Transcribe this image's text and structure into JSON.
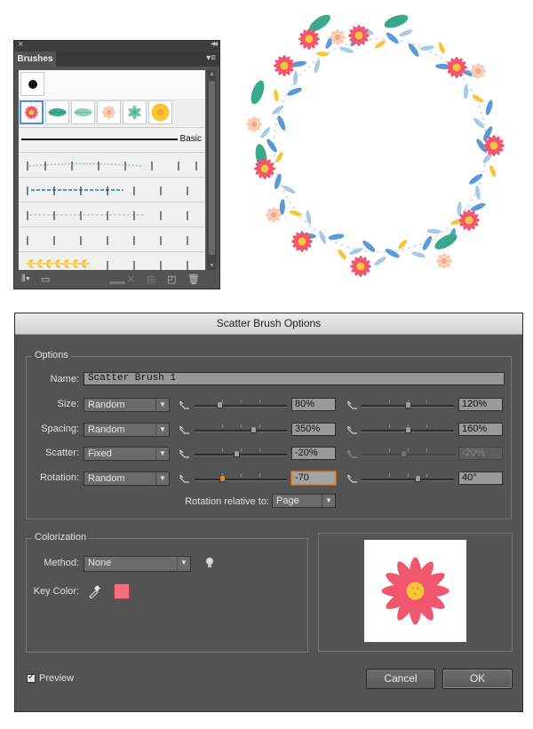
{
  "brushes_panel": {
    "tab_label": "Brushes",
    "close_glyph": "×",
    "collapse_glyph": "◂◂",
    "menu_glyph": "▾≡",
    "basic_label": "Basic",
    "footer_icons": [
      "brush-libraries-icon",
      "libraries-panel-icon",
      "remove-stroke-icon",
      "options-icon",
      "new-brush-icon",
      "delete-brush-icon"
    ],
    "scatter_swatches": [
      "pink-flower",
      "green-leaf",
      "mint-leaf",
      "peach-flower",
      "teal-flower",
      "yellow-flower"
    ]
  },
  "dialog": {
    "title": "Scatter Brush Options",
    "options_legend": "Options",
    "name_label": "Name:",
    "name_value": "Scatter Brush 1",
    "rows": [
      {
        "label": "Size:",
        "method": "Random",
        "min_value": "80%",
        "max_value": "120%",
        "min_level": 0.27,
        "max_level": 0.5,
        "dimmed_max": false
      },
      {
        "label": "Spacing:",
        "method": "Random",
        "min_value": "350%",
        "max_value": "160%",
        "min_level": 0.63,
        "max_level": 0.5,
        "dimmed_max": false
      },
      {
        "label": "Scatter:",
        "method": "Fixed",
        "min_value": "-20%",
        "max_value": "-20%",
        "min_level": 0.45,
        "max_level": 0.45,
        "dimmed_max": true
      },
      {
        "label": "Rotation:",
        "method": "Random",
        "min_value": "-70",
        "max_value": "40°",
        "min_level": 0.3,
        "max_level": 0.61,
        "dimmed_max": false
      }
    ],
    "rotation_relative_label": "Rotation relative to:",
    "rotation_relative_value": "Page",
    "colorization_legend": "Colorization",
    "method_label": "Method:",
    "method_value": "None",
    "key_color_label": "Key Color:",
    "key_color": "#f5707f",
    "preview_label": "Preview",
    "preview_checked": true,
    "cancel_label": "Cancel",
    "ok_label": "OK"
  },
  "colors": {
    "flower_pink": "#f0566e",
    "flower_center": "#f8c53a",
    "leaf_teal": "#3aa88c",
    "leaf_blue": "#5b9bd5",
    "peach": "#f8cdb8",
    "dialog_bg": "#535353"
  }
}
